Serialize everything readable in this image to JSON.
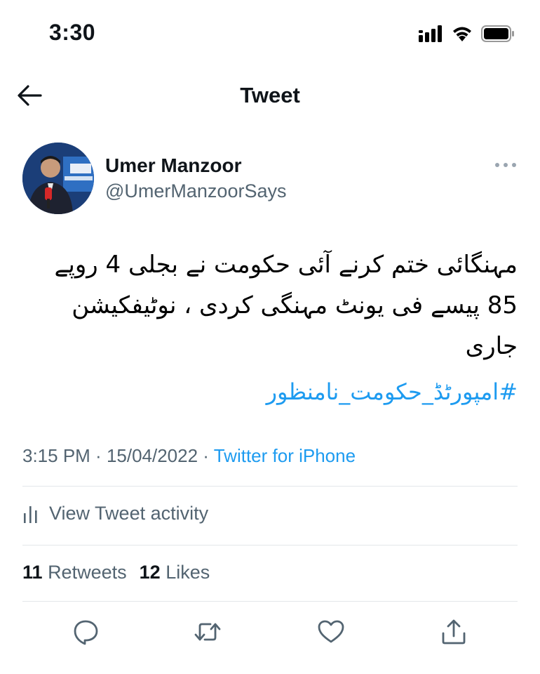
{
  "status_bar": {
    "time": "3:30"
  },
  "header": {
    "title": "Tweet"
  },
  "author": {
    "name": "Umer Manzoor",
    "handle": "@UmerManzoorSays"
  },
  "tweet": {
    "text": "مہنگائی ختم کرنے آئی حکومت نے بجلی 4 روپے 85 پیسے فی یونٹ مہنگی کردی ، نوٹیفکیشن جاری",
    "hashtag": "#امپورٹڈ_حکومت_نامنظور"
  },
  "meta": {
    "time": "3:15 PM",
    "separator1": " · ",
    "date": "15/04/2022",
    "separator2": " · ",
    "source": "Twitter for iPhone"
  },
  "activity": {
    "label": "View Tweet activity"
  },
  "stats": {
    "retweets_count": "11",
    "retweets_label": "Retweets",
    "likes_count": "12",
    "likes_label": "Likes"
  },
  "colors": {
    "accent": "#1d9bf0",
    "secondary_text": "#536471",
    "divider": "#e3e7ea"
  },
  "icons": [
    "back-arrow-icon",
    "more-icon",
    "reply-icon",
    "retweet-icon",
    "like-icon",
    "share-icon",
    "activity-chart-icon"
  ]
}
